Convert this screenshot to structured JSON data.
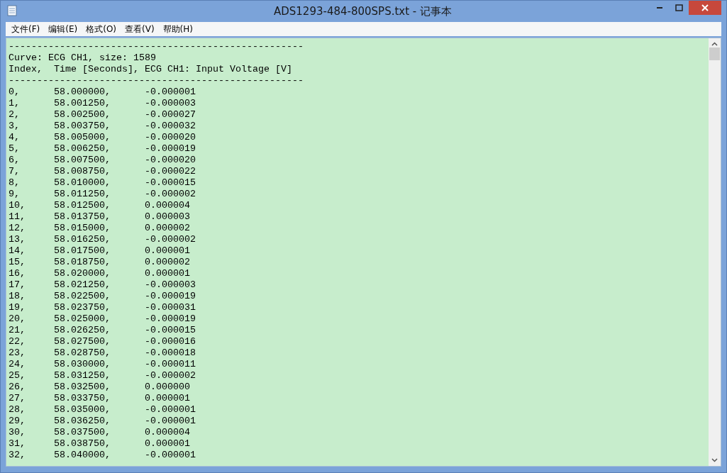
{
  "window": {
    "title": "ADS1293-484-800SPS.txt - 记事本"
  },
  "menu": [
    "文件(F)",
    "编辑(E)",
    "格式(O)",
    "查看(V)",
    "帮助(H)"
  ],
  "lines": [
    "----------------------------------------------------",
    "Curve: ECG CH1, size: 1589",
    "Index,  Time [Seconds], ECG CH1: Input Voltage [V]",
    "----------------------------------------------------",
    "0,\t58.000000,\t-0.000001",
    "1,\t58.001250,\t-0.000003",
    "2,\t58.002500,\t-0.000027",
    "3,\t58.003750,\t-0.000032",
    "4,\t58.005000,\t-0.000020",
    "5,\t58.006250,\t-0.000019",
    "6,\t58.007500,\t-0.000020",
    "7,\t58.008750,\t-0.000022",
    "8,\t58.010000,\t-0.000015",
    "9,\t58.011250,\t-0.000002",
    "10,\t58.012500,\t0.000004",
    "11,\t58.013750,\t0.000003",
    "12,\t58.015000,\t0.000002",
    "13,\t58.016250,\t-0.000002",
    "14,\t58.017500,\t0.000001",
    "15,\t58.018750,\t0.000002",
    "16,\t58.020000,\t0.000001",
    "17,\t58.021250,\t-0.000003",
    "18,\t58.022500,\t-0.000019",
    "19,\t58.023750,\t-0.000031",
    "20,\t58.025000,\t-0.000019",
    "21,\t58.026250,\t-0.000015",
    "22,\t58.027500,\t-0.000016",
    "23,\t58.028750,\t-0.000018",
    "24,\t58.030000,\t-0.000011",
    "25,\t58.031250,\t-0.000002",
    "26,\t58.032500,\t0.000000",
    "27,\t58.033750,\t0.000001",
    "28,\t58.035000,\t-0.000001",
    "29,\t58.036250,\t-0.000001",
    "30,\t58.037500,\t0.000004",
    "31,\t58.038750,\t0.000001",
    "32,\t58.040000,\t-0.000001"
  ]
}
